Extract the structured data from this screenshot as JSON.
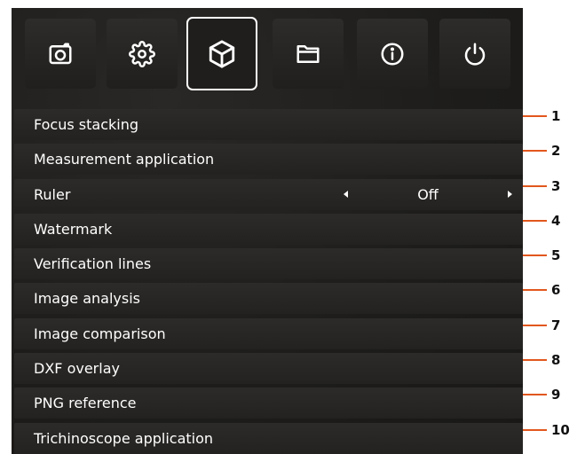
{
  "tabs": [
    {
      "icon": "camera-icon",
      "active": false
    },
    {
      "icon": "gear-icon",
      "active": false
    },
    {
      "icon": "cube-icon",
      "active": true
    },
    {
      "icon": "folder-icon",
      "active": false
    },
    {
      "icon": "info-icon",
      "active": false
    },
    {
      "icon": "power-icon",
      "active": false
    }
  ],
  "menu": {
    "items": [
      {
        "label": "Focus stacking",
        "callout": "1"
      },
      {
        "label": "Measurement application",
        "callout": "2"
      },
      {
        "label": "Ruler",
        "value": "Off",
        "callout": "3"
      },
      {
        "label": "Watermark",
        "callout": "4"
      },
      {
        "label": "Verification lines",
        "callout": "5"
      },
      {
        "label": "Image analysis",
        "callout": "6"
      },
      {
        "label": "Image comparison",
        "callout": "7"
      },
      {
        "label": "DXF overlay",
        "callout": "8"
      },
      {
        "label": "PNG reference",
        "callout": "9"
      },
      {
        "label": "Trichinoscope application",
        "callout": "10"
      }
    ]
  },
  "colors": {
    "callout_line": "#e2571e",
    "panel_background": "#1f1e1c",
    "text": "#ffffff"
  }
}
